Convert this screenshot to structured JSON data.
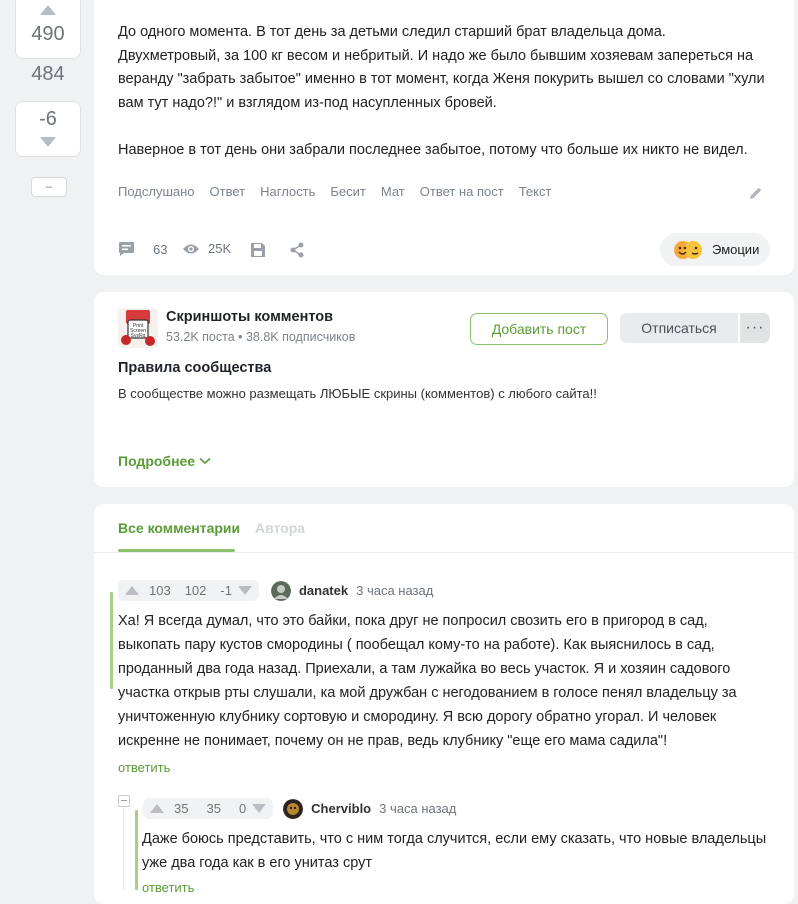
{
  "left_rail": {
    "upvotes": "490",
    "total": "484",
    "downvotes": "-6",
    "collapse": "–"
  },
  "post": {
    "paragraph1": "До одного момента. В тот день за детьми следил старший брат владельца дома. Двухметровый, за 100 кг весом и небритый. И надо же было бывшим хозяевам запереться на веранду \"забрать забытое\" именно в тот момент, когда Женя покурить вышел со словами \"хули вам тут надо?!\" и взглядом из-под насупленных бровей.",
    "paragraph2": "Наверное в тот день они забрали последнее забытое, потому что больше их никто не видел.",
    "tags": [
      "Подслушано",
      "Ответ",
      "Наглость",
      "Бесит",
      "Мат",
      "Ответ на пост",
      "Текст"
    ],
    "comments_count": "63",
    "views": "25K",
    "emotions_label": "Эмоции"
  },
  "community": {
    "name": "Скриншоты комментов",
    "meta": "53.2K поста • 38.8K подписчиков",
    "add_post": "Добавить пост",
    "unsubscribe": "Отписаться",
    "more": "···",
    "rules_title": "Правила сообщества",
    "rules_text": "В сообществе можно размещать ЛЮБЫЕ скрины (комментов) с любого сайта!!",
    "details": "Подробнее",
    "avatar_text": "Print Screen SysRq"
  },
  "tabs": {
    "all": "Все комментарии",
    "author": "Автора"
  },
  "comments": [
    {
      "up": "103",
      "rating": "102",
      "down": "-1",
      "author": "danatek",
      "time": "3 часа назад",
      "text": "Ха! Я всегда думал, что это байки, пока друг не попросил свозить его в пригород в сад, выкопать пару кустов смородины ( пообещал кому-то на работе). Как выяснилось в сад, проданный два года назад. Приехали, а там лужайка во весь участок. Я и хозяин садового участка открыв рты слушали, ка мой дружбан с негодованием в голосе пенял владельцу за уничтоженную клубнику сортовую и смородину. Я всю дорогу обратно угорал. И человек искренне не понимает, почему он не прав, ведь клубнику \"еще его мама садила\"!",
      "reply": "ответить"
    },
    {
      "up": "35",
      "rating": "35",
      "down": "0",
      "author": "Cherviblo",
      "time": "3 часа назад",
      "text": "Даже боюсь представить, что с ним тогда случится, если ему сказать, что новые владельцы уже два года как в его унитаз срут",
      "reply": "ответить"
    }
  ],
  "colors": {
    "accent": "#5a9c37",
    "accent_light": "#8ac16b",
    "muted": "#6e747b"
  }
}
